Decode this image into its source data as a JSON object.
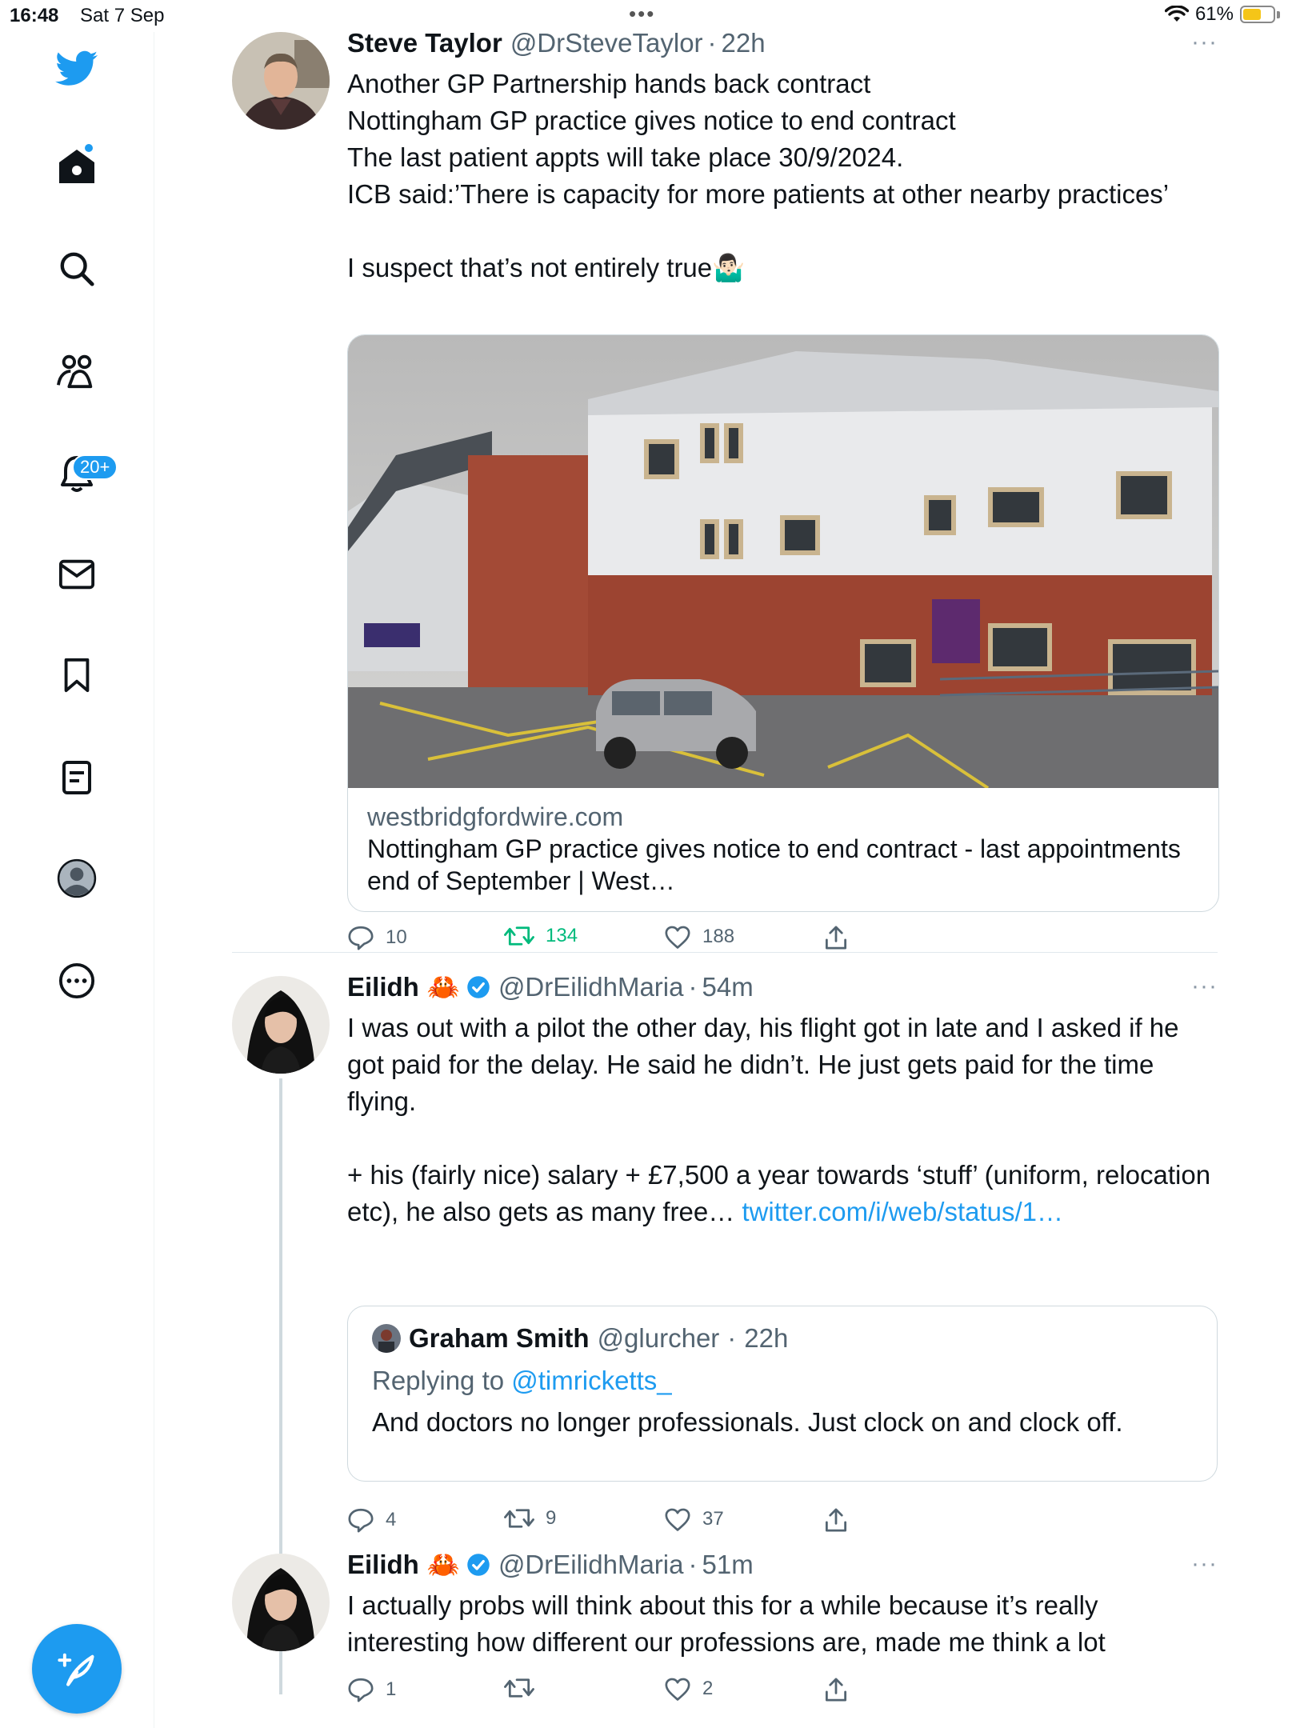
{
  "status_bar": {
    "time": "16:48",
    "date": "Sat 7 Sep",
    "battery_percent": "61%",
    "battery_level": 0.61
  },
  "sidebar": {
    "items": [
      {
        "icon": "twitter-bird-icon"
      },
      {
        "icon": "home-icon",
        "has_dot": true
      },
      {
        "icon": "search-icon"
      },
      {
        "icon": "communities-icon"
      },
      {
        "icon": "notifications-bell-icon",
        "badge": "20+"
      },
      {
        "icon": "messages-envelope-icon"
      },
      {
        "icon": "bookmark-icon"
      },
      {
        "icon": "lists-icon"
      },
      {
        "icon": "profile-icon"
      },
      {
        "icon": "more-circle-icon"
      }
    ],
    "compose_icon": "compose-feather-icon",
    "accent": "#1d9bf0"
  },
  "tweets": [
    {
      "name": "Steve Taylor",
      "handle": "@DrSteveTaylor",
      "sep": "·",
      "time": "22h",
      "more": "···",
      "lines": [
        "Another GP Partnership hands back contract",
        "Nottingham GP practice gives notice to end contract",
        "The last patient appts will take place 30/9/2024.",
        "ICB said:’There is capacity for more patients at other nearby practices’",
        "",
        "I suspect that’s not entirely true🤷🏻‍♂️"
      ],
      "card": {
        "domain": "westbridgfordwire.com",
        "title": "Nottingham GP practice gives notice to end contract - last appointments end of September | West…"
      },
      "replies": "10",
      "retweets": "134",
      "likes": "188"
    },
    {
      "name": "Eilidh",
      "emoji": "🦀",
      "handle": "@DrEilidhMaria",
      "sep": "·",
      "time": "54m",
      "more": "···",
      "para1": "I was out with a pilot the other day, his flight got in late and I asked if he got paid for the delay. He said he didn’t. He just gets paid for the time flying.",
      "para2": "+ his (fairly nice) salary + £7,500 a year towards ‘stuff’ (uniform, relocation etc), he also gets as many free… ",
      "para2_link": "twitter.com/i/web/status/1…",
      "quote": {
        "name": "Graham Smith",
        "handle": "@glurcher",
        "sep": "·",
        "time": "22h",
        "replying_to_label": "Replying to ",
        "replying_to_handle": "@timricketts_",
        "text": "And doctors no longer professionals. Just clock on and clock off."
      },
      "replies": "4",
      "retweets": "9",
      "likes": "37"
    },
    {
      "name": "Eilidh",
      "emoji": "🦀",
      "handle": "@DrEilidhMaria",
      "sep": "·",
      "time": "51m",
      "more": "···",
      "text": "I actually probs will think about this for a while because it’s really interesting how different our professions are, made me think a lot",
      "replies": "1",
      "retweets": "",
      "likes": "2"
    }
  ],
  "colors": {
    "link": "#1d9bf0",
    "retweet_active": "#00ba7c",
    "secondary_text": "#536471"
  }
}
